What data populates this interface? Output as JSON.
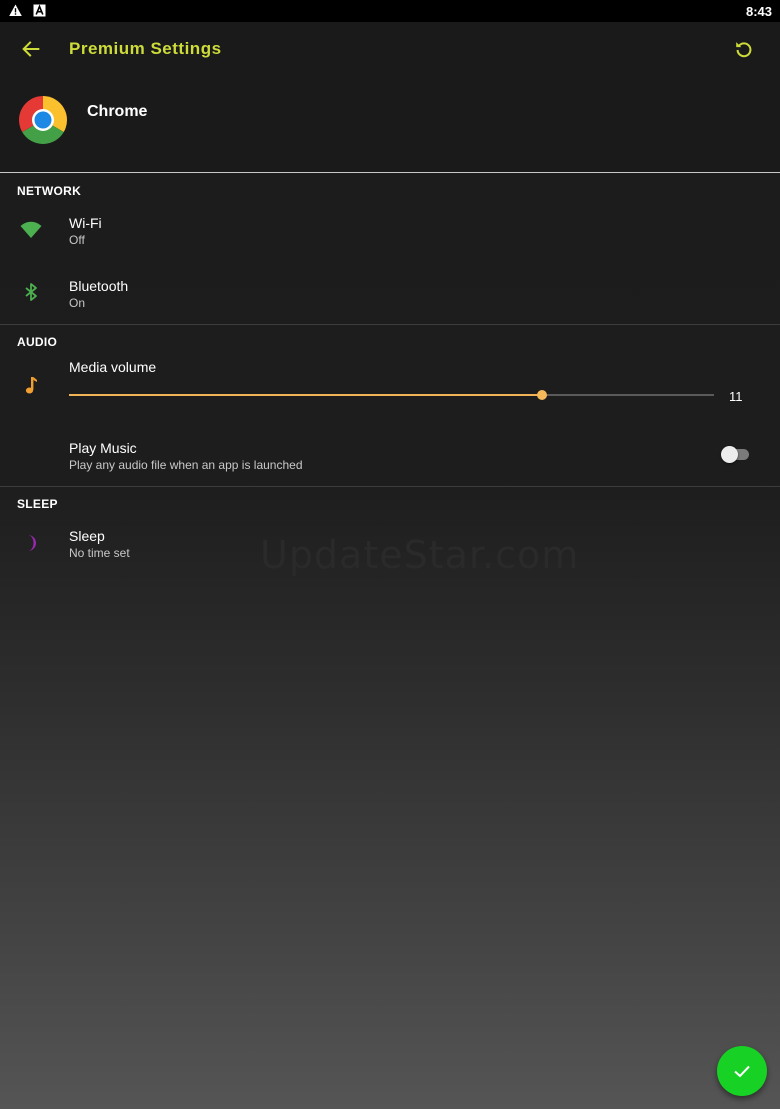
{
  "status_bar": {
    "time": "8:43",
    "icons": [
      "warning-icon",
      "android-icon"
    ]
  },
  "app_bar": {
    "title": "Premium Settings",
    "back_icon": "back-arrow-icon",
    "reset_icon": "reset-icon",
    "accent_color": "#cddc39"
  },
  "app_header": {
    "name": "Chrome",
    "logo_icon": "chrome-logo-icon"
  },
  "sections": {
    "network": {
      "title": "NETWORK",
      "wifi": {
        "title": "Wi-Fi",
        "subtitle": "Off",
        "icon": "wifi-icon",
        "icon_color": "#4caf50"
      },
      "bluetooth": {
        "title": "Bluetooth",
        "subtitle": "On",
        "icon": "bluetooth-icon",
        "icon_color": "#4caf50"
      }
    },
    "audio": {
      "title": "AUDIO",
      "media_volume": {
        "title": "Media volume",
        "value": "11",
        "level_fraction": 0.733,
        "icon": "music-note-icon",
        "icon_color": "#f0a030"
      },
      "play_music": {
        "title": "Play Music",
        "subtitle": "Play any audio file when an app is launched",
        "enabled": false
      }
    },
    "sleep": {
      "title": "SLEEP",
      "sleep": {
        "title": "Sleep",
        "subtitle": "No time set",
        "icon": "moon-icon",
        "icon_color": "#9c27b0"
      }
    }
  },
  "watermark": "UpdateStar.com",
  "fab": {
    "icon": "check-icon",
    "color": "#17d124"
  }
}
